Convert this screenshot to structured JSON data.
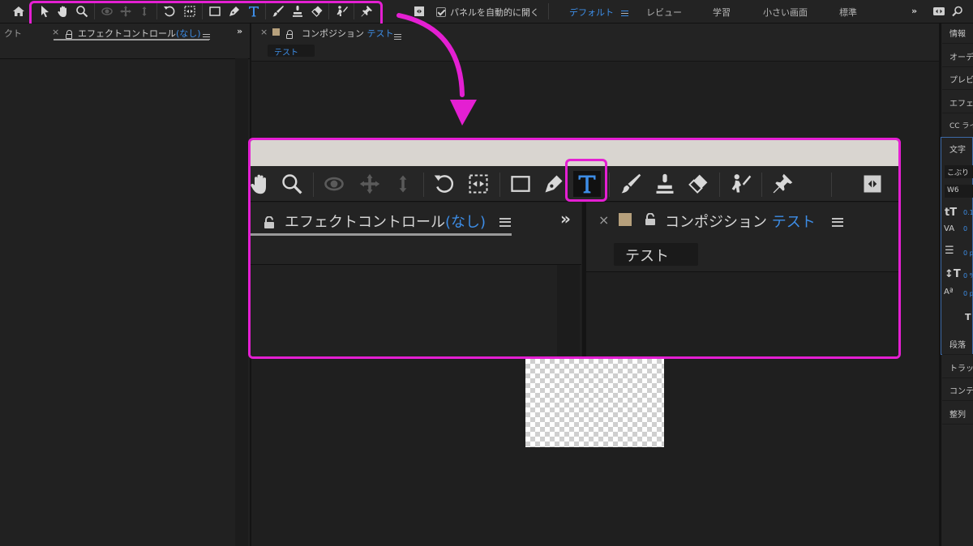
{
  "toolbar": {
    "tools": [
      "home-icon",
      "selection-icon",
      "hand-icon",
      "zoom-icon",
      "orbit-icon",
      "pan-icon",
      "dolly-icon",
      "rotate-icon",
      "anchor-icon",
      "rectangle-icon",
      "pen-icon",
      "type-icon",
      "brush-icon",
      "clone-stamp-icon",
      "eraser-icon",
      "roto-brush-icon",
      "puppet-pin-icon"
    ],
    "auto_open_label": "パネルを自動的に開く",
    "auto_open_checked": true,
    "workspaces": [
      "デフォルト",
      "レビュー",
      "学習",
      "小さい画面",
      "標準"
    ],
    "active_workspace": "デフォルト",
    "overflow": "»"
  },
  "left_panel": {
    "tab_partial": "クト",
    "close": "×",
    "effects_title": "エフェクトコントロール",
    "effects_target": "(なし)",
    "overflow": "»"
  },
  "comp_panel": {
    "close": "×",
    "title": "コンポジション",
    "comp_name": "テスト",
    "comp_tab": "テスト"
  },
  "right_panel": {
    "items": [
      "情報",
      "オーデ",
      "プレビ",
      "エフェ",
      "CC ライ"
    ],
    "char_title": "文字",
    "font_name": "こぶり",
    "font_weight": "W6",
    "size_val": "0.1",
    "tracking_val": "0",
    "lead_val": "0 p",
    "vscale_val": "0 %",
    "baseline_val": "0 p",
    "lower_items": [
      "段落",
      "トラッ",
      "コンテ",
      "整列"
    ]
  },
  "zoom": {
    "effects_title": "エフェクトコントロール",
    "effects_target": "(なし)",
    "overflow": "»",
    "close": "×",
    "comp_title": "コンポジション",
    "comp_name": "テスト",
    "comp_tab": "テスト"
  },
  "colors": {
    "highlight": "#e41fd2",
    "accent_blue": "#3d8de6",
    "background": "#1d1d1d"
  }
}
